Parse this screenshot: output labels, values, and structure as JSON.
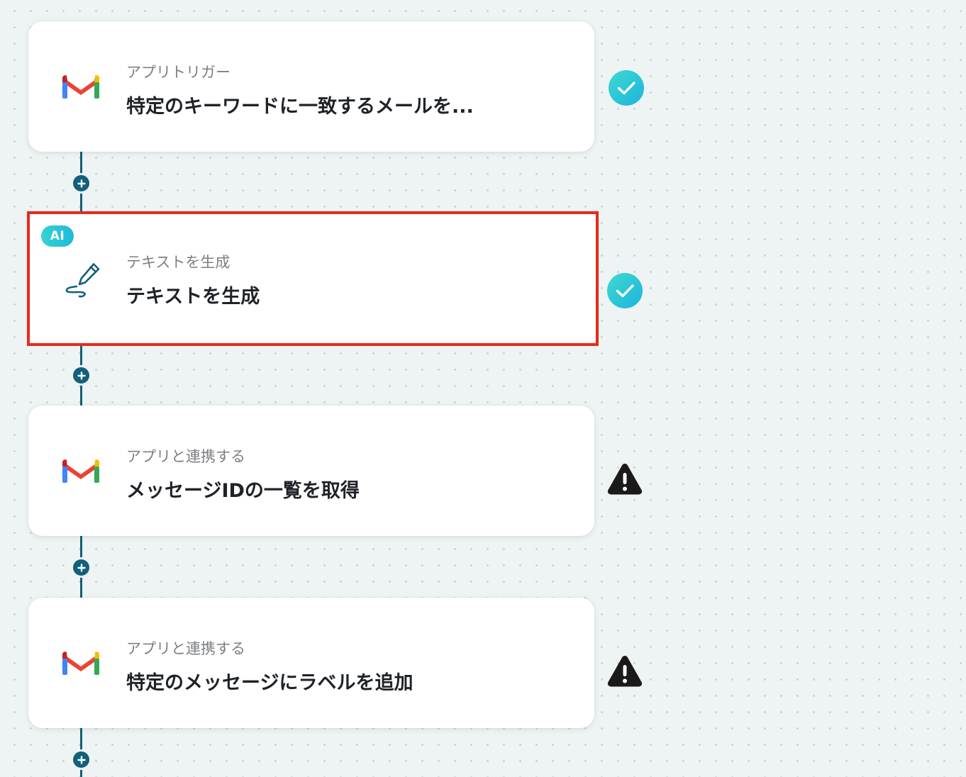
{
  "steps": [
    {
      "type_label": "アプリトリガー",
      "title": "特定のキーワードに一致するメールを...",
      "icon": "gmail-icon",
      "status": "complete"
    },
    {
      "type_label": "テキストを生成",
      "title": "テキストを生成",
      "icon": "pen-icon",
      "status": "complete",
      "badge": "AI",
      "selected": true
    },
    {
      "type_label": "アプリと連携する",
      "title": "メッセージIDの一覧を取得",
      "icon": "gmail-icon",
      "status": "warning"
    },
    {
      "type_label": "アプリと連携する",
      "title": "特定のメッセージにラベルを追加",
      "icon": "gmail-icon",
      "status": "warning"
    }
  ],
  "colors": {
    "selection_outline": "#e8291c",
    "connector": "#13607a",
    "success": "#2cc5d8",
    "warning": "#1a1a1a"
  }
}
